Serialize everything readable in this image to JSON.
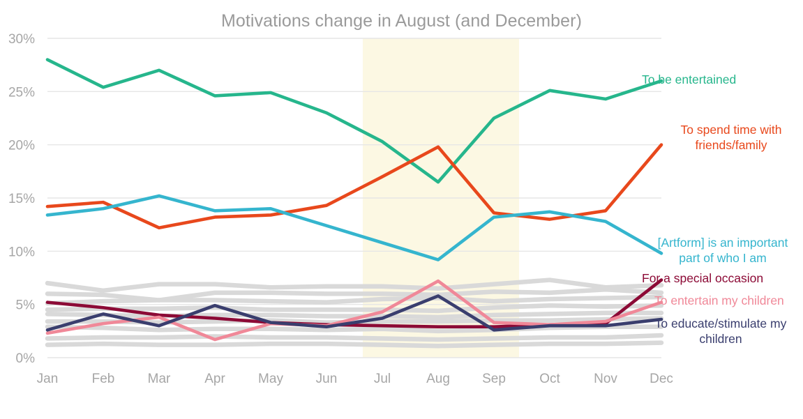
{
  "chart_data": {
    "type": "line",
    "title": "Motivations change in August (and December)",
    "xlabel": "",
    "ylabel": "",
    "categories": [
      "Jan",
      "Feb",
      "Mar",
      "Apr",
      "May",
      "Jun",
      "Jul",
      "Aug",
      "Sep",
      "Oct",
      "Nov",
      "Dec"
    ],
    "ylim": [
      0,
      30
    ],
    "yticks": [
      "0%",
      "5%",
      "10%",
      "15%",
      "20%",
      "25%",
      "30%"
    ],
    "ytick_values": [
      0,
      5,
      10,
      15,
      20,
      25,
      30
    ],
    "grid": "horizontal",
    "legend_position": "right-inline-labels",
    "y_axis_format": "percent",
    "annotations": [
      {
        "type": "highlight-band",
        "name": "august-highlight-band",
        "from": "Jul-mid",
        "to": "Sep-mid",
        "color": "#fcf8e3",
        "note": "Shaded band covering the Jul-Sep period"
      }
    ],
    "series": [
      {
        "name": "To be entertained",
        "color": "#26b68c",
        "highlighted": true,
        "values": [
          28.0,
          25.4,
          27.0,
          24.6,
          24.9,
          23.0,
          20.3,
          16.5,
          22.5,
          25.1,
          24.3,
          26.0
        ]
      },
      {
        "name": "To spend time with friends/family",
        "color": "#e8481c",
        "highlighted": true,
        "values": [
          14.2,
          14.6,
          12.2,
          13.2,
          13.4,
          14.3,
          17.0,
          19.8,
          13.6,
          13.0,
          13.8,
          20.0
        ]
      },
      {
        "name": "[Artform] is an important part of who I am",
        "color": "#35b5ce",
        "highlighted": true,
        "values": [
          13.4,
          14.0,
          15.2,
          13.8,
          14.0,
          12.4,
          10.8,
          9.2,
          13.2,
          13.7,
          12.8,
          9.8
        ]
      },
      {
        "name": "For a special occasion",
        "color": "#8c0a36",
        "highlighted": true,
        "values": [
          5.2,
          4.7,
          4.0,
          3.7,
          3.3,
          3.1,
          3.0,
          2.9,
          2.9,
          3.1,
          3.2,
          7.3
        ]
      },
      {
        "name": "To entertain my children",
        "color": "#f08898",
        "highlighted": true,
        "values": [
          2.3,
          3.2,
          3.8,
          1.7,
          3.2,
          3.0,
          4.3,
          7.2,
          3.3,
          3.1,
          3.4,
          5.2
        ]
      },
      {
        "name": "To educate/stimulate my children",
        "color": "#3a3e6e",
        "highlighted": true,
        "values": [
          2.6,
          4.1,
          3.0,
          4.9,
          3.3,
          2.9,
          3.7,
          5.8,
          2.6,
          3.0,
          3.0,
          3.6
        ]
      },
      {
        "name": "background series 1",
        "color": "#d9d9d9",
        "highlighted": false,
        "values": [
          7.0,
          6.3,
          6.9,
          6.9,
          6.6,
          6.7,
          6.7,
          6.5,
          6.9,
          7.3,
          6.6,
          6.8
        ]
      },
      {
        "name": "background series 2",
        "color": "#d9d9d9",
        "highlighted": false,
        "values": [
          6.0,
          5.9,
          5.4,
          6.1,
          6.1,
          6.0,
          6.0,
          5.9,
          6.2,
          6.1,
          6.4,
          6.1
        ]
      },
      {
        "name": "background series 3",
        "color": "#d9d9d9",
        "highlighted": false,
        "values": [
          5.1,
          5.3,
          5.4,
          5.4,
          5.3,
          5.2,
          5.5,
          5.6,
          5.3,
          5.5,
          5.6,
          5.7
        ]
      },
      {
        "name": "background series 4",
        "color": "#d9d9d9",
        "highlighted": false,
        "values": [
          4.5,
          4.6,
          4.6,
          4.7,
          4.5,
          4.5,
          4.5,
          4.4,
          4.7,
          4.9,
          4.8,
          4.9
        ]
      },
      {
        "name": "background series 5",
        "color": "#d9d9d9",
        "highlighted": false,
        "values": [
          4.1,
          4.0,
          3.9,
          4.0,
          4.0,
          3.9,
          3.9,
          3.8,
          4.0,
          4.1,
          4.2,
          4.2
        ]
      },
      {
        "name": "background series 6",
        "color": "#d9d9d9",
        "highlighted": false,
        "values": [
          3.4,
          3.4,
          3.3,
          3.4,
          3.5,
          3.3,
          3.4,
          3.4,
          3.5,
          3.5,
          3.6,
          3.7
        ]
      },
      {
        "name": "background series 7",
        "color": "#d9d9d9",
        "highlighted": false,
        "values": [
          2.9,
          2.8,
          2.6,
          2.7,
          2.7,
          2.6,
          2.7,
          2.5,
          2.6,
          2.8,
          2.9,
          2.9
        ]
      },
      {
        "name": "background series 8",
        "color": "#d9d9d9",
        "highlighted": false,
        "values": [
          1.8,
          1.9,
          1.9,
          2.0,
          1.9,
          1.9,
          1.8,
          1.7,
          1.8,
          1.9,
          1.9,
          2.1
        ]
      },
      {
        "name": "background series 9",
        "color": "#d9d9d9",
        "highlighted": false,
        "values": [
          1.2,
          1.3,
          1.2,
          1.2,
          1.3,
          1.3,
          1.2,
          1.1,
          1.2,
          1.3,
          1.3,
          1.4
        ]
      }
    ]
  },
  "labels": {
    "entertained": "To be entertained",
    "spend_time": "To spend time with\nfriends/family",
    "artform": "[Artform] is an important\npart of who I am",
    "special_occasion": "For a special occasion",
    "entertain_children": "To entertain my children",
    "educate_children": "To educate/stimulate my\nchildren"
  },
  "colors": {
    "entertained": "#26b68c",
    "spend_time": "#e8481c",
    "artform": "#35b5ce",
    "special_occasion": "#8c0a36",
    "entertain_children": "#f08898",
    "educate_children": "#3a3e6e",
    "background_series": "#d9d9d9",
    "highlight_band": "#fcf8e3",
    "gridline": "#e6e6e6",
    "tick_text": "#a6a6a6",
    "title_text": "#9a9a9a"
  }
}
